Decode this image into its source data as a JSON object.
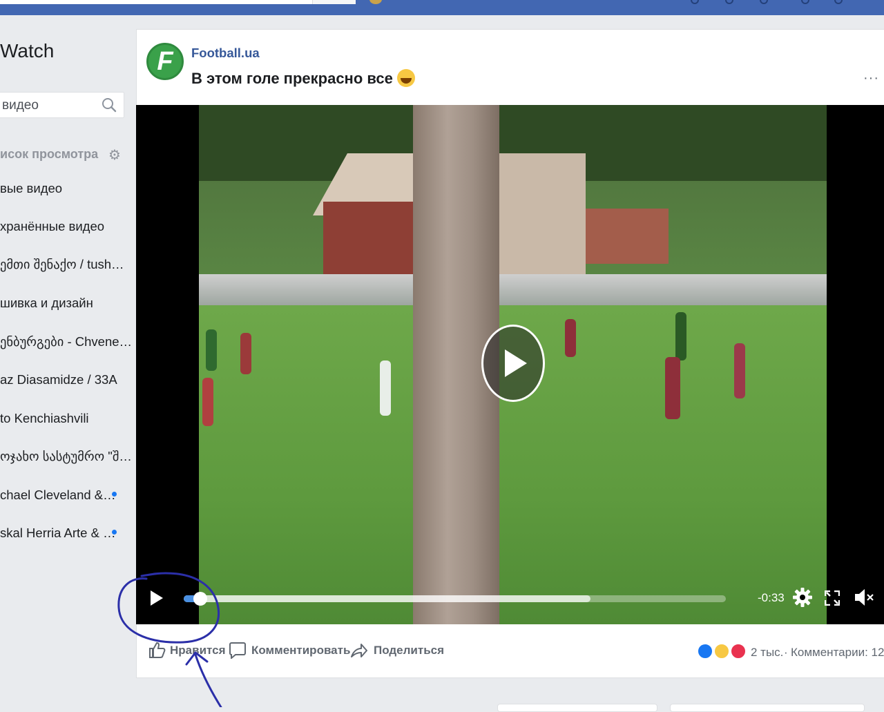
{
  "topbar": {
    "accent": "#4267b2"
  },
  "sidebar": {
    "title": "Watch",
    "search_text": "видео",
    "section_title": "исок просмотра",
    "items": [
      {
        "label": "вые видео",
        "dot": false
      },
      {
        "label": "хранённые видео",
        "dot": false
      },
      {
        "label": "ემთი შენაქო / tush…",
        "dot": false
      },
      {
        "label": "шивка и дизайн",
        "dot": false
      },
      {
        "label": "ენბურგები - Chvene…",
        "dot": false
      },
      {
        "label": "az Diasamidze / 33A",
        "dot": false
      },
      {
        "label": "to Kenchiashvili",
        "dot": false
      },
      {
        "label": "ოჯახო სასტუმრო \"შ…",
        "dot": false
      },
      {
        "label": "chael Cleveland &…",
        "dot": true
      },
      {
        "label": "skal Herria Arte & …",
        "dot": true
      }
    ]
  },
  "post": {
    "page_name": "Football.ua",
    "logo_letter": "F",
    "text": "В этом голе прекрасно все",
    "more": "···"
  },
  "video": {
    "time_remaining": "-0:33",
    "progress_fraction": 0.03,
    "buffered_fraction": 0.75
  },
  "actions": {
    "like": "Нравится",
    "comment": "Комментировать",
    "share": "Поделиться"
  },
  "stats": {
    "reactions_count": "2 тыс.",
    "separator": "·",
    "comments": "Комментарии: 12"
  },
  "colors": {
    "link": "#365899",
    "like_blue": "#1877f2",
    "annotation": "#2b2fa8"
  }
}
